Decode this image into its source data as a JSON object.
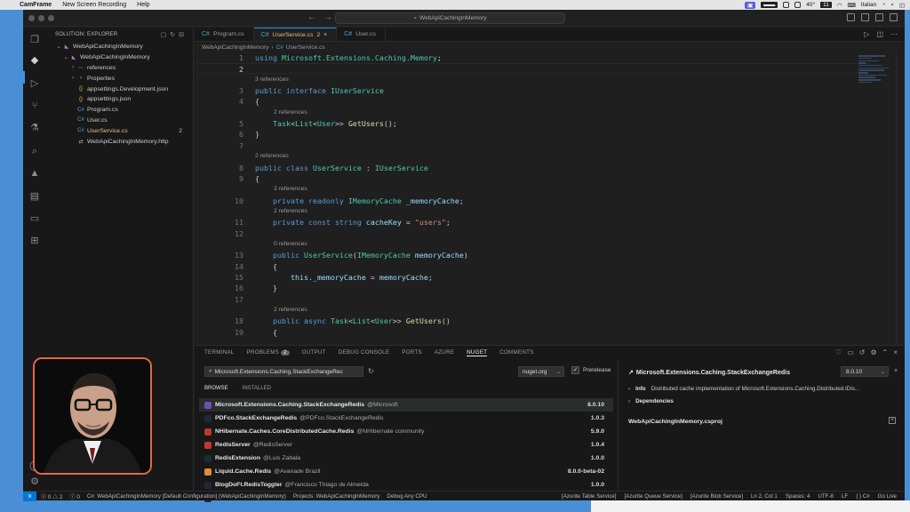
{
  "menubar": {
    "app_name": "CamFrame",
    "items": [
      "New Screen Recording",
      "Help"
    ],
    "right": {
      "temp": "40°",
      "keyboard": "Italian",
      "badge": "11"
    }
  },
  "titlebar": {
    "command_center": "WebApiCachingInMemory"
  },
  "sidebar": {
    "header": "SOLUTION: EXPLORER",
    "tree": [
      {
        "label": "WebApiCachingInMemory",
        "indent": 0,
        "twisty": "v",
        "icon": "vs"
      },
      {
        "label": "WebApiCachingInMemory",
        "indent": 1,
        "twisty": "v",
        "icon": "vs"
      },
      {
        "label": "references",
        "indent": 2,
        "twisty": ">",
        "icon": "ref"
      },
      {
        "label": "Properties",
        "indent": 2,
        "twisty": ">",
        "icon": "folder"
      },
      {
        "label": "appsettings.Development.json",
        "indent": 2,
        "twisty": "",
        "icon": "json"
      },
      {
        "label": "appsettings.json",
        "indent": 2,
        "twisty": "",
        "icon": "json"
      },
      {
        "label": "Program.cs",
        "indent": 2,
        "twisty": "",
        "icon": "cs"
      },
      {
        "label": "User.cs",
        "indent": 2,
        "twisty": "",
        "icon": "cs"
      },
      {
        "label": "UserService.cs",
        "indent": 2,
        "twisty": "",
        "icon": "cs",
        "modified": true,
        "badge": "2"
      },
      {
        "label": "WebApiCachingInMemory.http",
        "indent": 2,
        "twisty": "",
        "icon": "http"
      }
    ]
  },
  "tabs": [
    {
      "label": "Program.cs",
      "active": false
    },
    {
      "label": "UserService.cs",
      "active": true,
      "count": "2"
    },
    {
      "label": "User.cs",
      "active": false
    }
  ],
  "breadcrumb": [
    "WebApiCachingInMemory",
    "UserService.cs"
  ],
  "code": [
    {
      "ln": "1",
      "text": "using Microsoft.Extensions.Caching.Memory;"
    },
    {
      "ln": "2",
      "text": "",
      "current": true
    },
    {
      "lens": "3 references",
      "indent": 0
    },
    {
      "ln": "3",
      "text": "public interface IUserService"
    },
    {
      "ln": "4",
      "text": "{"
    },
    {
      "lens": "2 references",
      "indent": 1
    },
    {
      "ln": "5",
      "text": "    Task<List<User>> GetUsers();"
    },
    {
      "ln": "6",
      "text": "}"
    },
    {
      "ln": "7",
      "text": ""
    },
    {
      "lens": "2 references",
      "indent": 0
    },
    {
      "ln": "8",
      "text": "public class UserService : IUserService"
    },
    {
      "ln": "9",
      "text": "{"
    },
    {
      "lens": "3 references",
      "indent": 1
    },
    {
      "ln": "10",
      "text": "    private readonly IMemoryCache _memoryCache;"
    },
    {
      "lens": "2 references",
      "indent": 1
    },
    {
      "ln": "11",
      "text": "    private const string cacheKey = \"users\";"
    },
    {
      "ln": "12",
      "text": ""
    },
    {
      "lens": "0 references",
      "indent": 1
    },
    {
      "ln": "13",
      "text": "    public UserService(IMemoryCache memoryCache)"
    },
    {
      "ln": "14",
      "text": "    {"
    },
    {
      "ln": "15",
      "text": "        this._memoryCache = memoryCache;"
    },
    {
      "ln": "16",
      "text": "    }"
    },
    {
      "ln": "17",
      "text": ""
    },
    {
      "lens": "2 references",
      "indent": 1
    },
    {
      "ln": "18",
      "text": "    public async Task<List<User>> GetUsers()"
    },
    {
      "ln": "19",
      "text": "    {"
    }
  ],
  "panel": {
    "tabs": [
      {
        "label": "TERMINAL"
      },
      {
        "label": "PROBLEMS",
        "badge": "2"
      },
      {
        "label": "OUTPUT"
      },
      {
        "label": "DEBUG CONSOLE"
      },
      {
        "label": "PORTS"
      },
      {
        "label": "AZURE"
      },
      {
        "label": "NUGET",
        "active": true
      },
      {
        "label": "COMMENTS"
      }
    ],
    "nuget": {
      "search_value": "Microsoft.Extensions.Caching.StackExchangeRec",
      "source": "nuget.org",
      "prerelease_label": "Prerelease",
      "browse_label": "BROWSE",
      "installed_label": "INSTALLED",
      "packages": [
        {
          "name": "Microsoft.Extensions.Caching.StackExchangeRedis",
          "author": "@Microsoft",
          "version": "8.0.10",
          "color": "#6b4fbb",
          "selected": true
        },
        {
          "name": "PDFco.StackExchangeRedis",
          "author": "@PDFco.StackExchangeRedis",
          "version": "1.0.3",
          "color": "#1e2a3a"
        },
        {
          "name": "NHibernate.Caches.CoreDistributedCache.Redis",
          "author": "@NHibernate community",
          "version": "5.9.0",
          "color": "#c0392b"
        },
        {
          "name": "RedisServer",
          "author": "@RedisServer",
          "version": "1.0.4",
          "color": "#c0392b"
        },
        {
          "name": "RedisExtension",
          "author": "@Luis Zabala",
          "version": "1.0.0",
          "color": "#1e2a3a"
        },
        {
          "name": "Liquid.Cache.Redis",
          "author": "@Avanade Brazil",
          "version": "8.0.0-beta-02",
          "color": "#e08a3c"
        },
        {
          "name": "BlogDoFt.RedisToggler",
          "author": "@Francisco Thiago de Almeida",
          "version": "1.0.0",
          "color": "#1e2a3a"
        },
        {
          "name": "LBussness",
          "author": "@LBussness",
          "version": "1.1.5",
          "color": "#1e2a3a"
        }
      ],
      "detail": {
        "name": "Microsoft.Extensions.Caching.StackExchangeRedis",
        "version": "8.0.10",
        "info_label": "Info",
        "info_text": "Distributed cache implementation of Microsoft.Extensions.Caching.Distributed.IDis...",
        "dependencies_label": "Dependencies",
        "project": "WebApiCachingInMemory.csproj"
      }
    }
  },
  "statusbar": {
    "errors": "0",
    "warnings": "2",
    "info": "0",
    "context": "C#: WebApiCachingInMemory [Default Configuration] (WebApiCachingInMemory)",
    "projects": "Projects: WebApiCachingInMemory",
    "debug": "Debug Any CPU",
    "right": [
      "[Azurite Table Service]",
      "[Azurite Queue Service]",
      "[Azurite Blob Service]",
      "Ln 2, Col 1",
      "Spaces: 4",
      "UTF-8",
      "LF",
      "{ } C#",
      "Go Live"
    ]
  }
}
